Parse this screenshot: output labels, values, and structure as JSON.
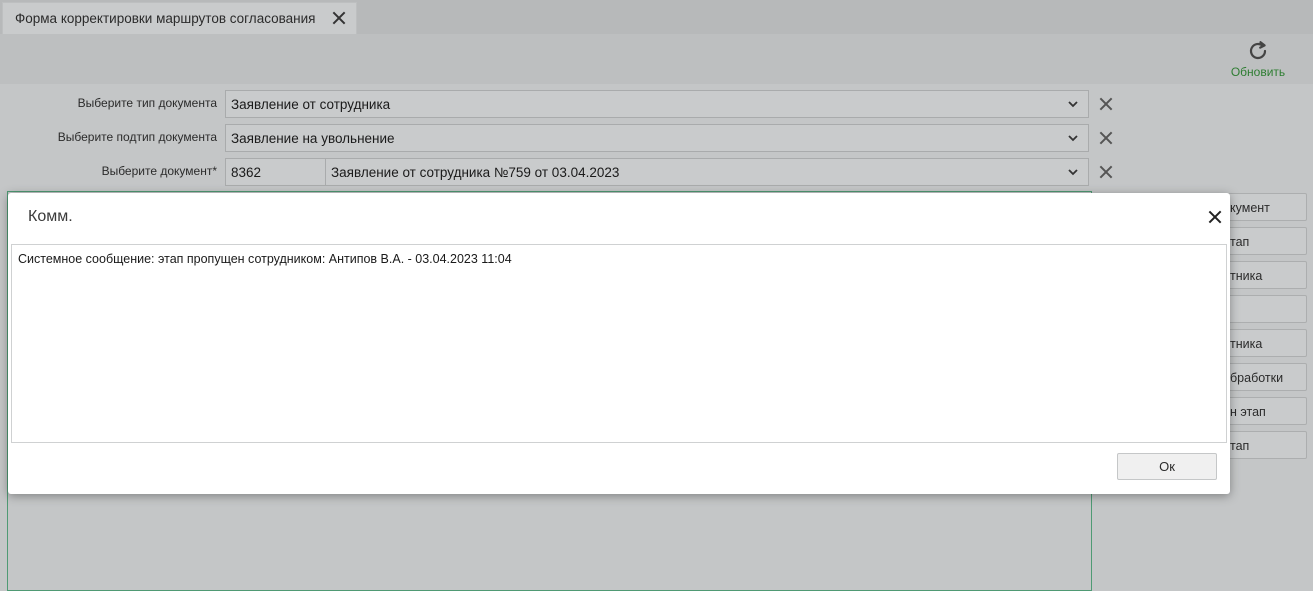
{
  "tab": {
    "title": "Форма корректировки маршрутов согласования"
  },
  "toolbar": {
    "refresh_label": "Обновить"
  },
  "form": {
    "doc_type": {
      "label": "Выберите тип документа",
      "value": "Заявление от сотрудника"
    },
    "doc_subtype": {
      "label": "Выберите подтип документа",
      "value": "Заявление на увольнение"
    },
    "document": {
      "label": "Выберите документ*",
      "code": "8362",
      "value": "Заявление от сотрудника №759 от 03.04.2023"
    }
  },
  "side_buttons": [
    {
      "label": "кумент"
    },
    {
      "label": "тап"
    },
    {
      "label": "тника"
    },
    {
      "label": ""
    },
    {
      "label": "тника"
    },
    {
      "label": "бработки"
    },
    {
      "label": "н этап"
    },
    {
      "label": "тап"
    }
  ],
  "modal": {
    "title": "Комм.",
    "comment": "Системное сообщение: этап пропущен сотрудником: Антипов В.А. - 03.04.2023 11:04",
    "ok_label": "Ок"
  },
  "colors": {
    "accent_green": "#2e7d32",
    "panel_border": "#4f9a74"
  }
}
